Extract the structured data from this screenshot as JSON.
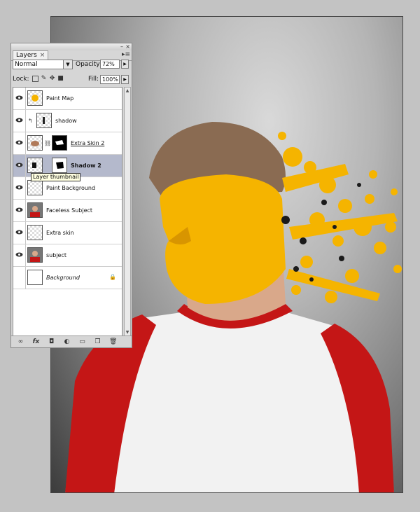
{
  "panel": {
    "tab_label": "Layers",
    "tab_close": "×",
    "menu_glyph": "▸≡",
    "blend_mode": "Normal",
    "opacity_label": "Opacity:",
    "opacity_value": "72%",
    "lock_label": "Lock:",
    "fill_label": "Fill:",
    "fill_value": "100%"
  },
  "layers": [
    {
      "name": "Paint Map",
      "visible": true,
      "selected": false
    },
    {
      "name": "shadow",
      "visible": true,
      "selected": false
    },
    {
      "name": "Extra Skin 2",
      "visible": true,
      "selected": false
    },
    {
      "name": "Shadow 2",
      "visible": true,
      "selected": true
    },
    {
      "name": "Paint Background",
      "visible": true,
      "selected": false
    },
    {
      "name": "Faceless Subject",
      "visible": true,
      "selected": false
    },
    {
      "name": "Extra skin",
      "visible": true,
      "selected": false
    },
    {
      "name": "subject",
      "visible": true,
      "selected": false
    },
    {
      "name": "Background",
      "visible": false,
      "selected": false
    }
  ],
  "tooltip": "Layer thumbnail",
  "bottom_icons": [
    "link-icon",
    "fx-icon",
    "mask-icon",
    "adjustment-icon",
    "folder-icon",
    "new-layer-icon",
    "trash-icon"
  ],
  "colors": {
    "selection": "#b4b9cc",
    "paint": "#f5b400",
    "shirt_red": "#c41616"
  }
}
